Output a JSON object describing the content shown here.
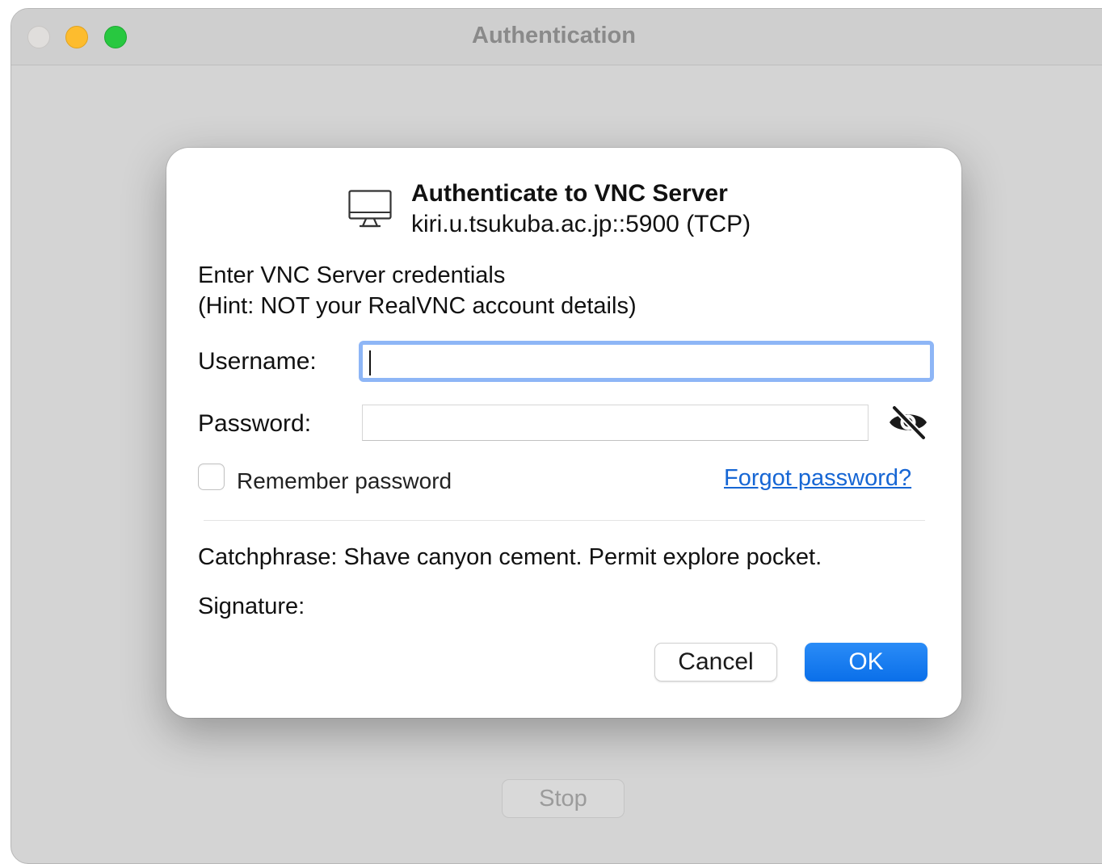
{
  "window": {
    "title": "Authentication",
    "stop_label": "Stop"
  },
  "dialog": {
    "title": "Authenticate to VNC Server",
    "server": "kiri.u.tsukuba.ac.jp::5900 (TCP)",
    "prompt_line1": "Enter VNC Server credentials",
    "prompt_line2": "(Hint: NOT your RealVNC account details)",
    "username_label": "Username:",
    "username_value": "",
    "password_label": "Password:",
    "password_value": "",
    "password_toggle_icon": "eye-slash-icon",
    "remember_label": "Remember password",
    "remember_checked": false,
    "forgot_label": "Forgot password?",
    "catchphrase": "Catchphrase: Shave canyon cement. Permit explore pocket.",
    "signature": "Signature:",
    "cancel_label": "Cancel",
    "ok_label": "OK"
  },
  "colors": {
    "accent": "#0a6fe9",
    "link": "#1666d4",
    "focus_ring": "#8eb6f6",
    "traffic_close": "#e0dedc",
    "traffic_minimize": "#fdbc2e",
    "traffic_maximize": "#28c840"
  }
}
